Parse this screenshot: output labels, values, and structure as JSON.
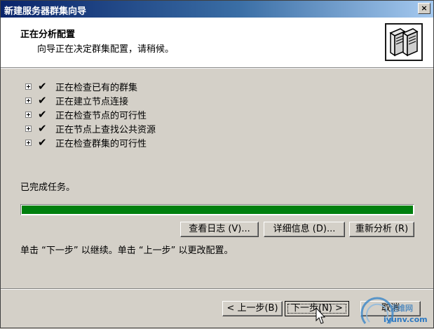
{
  "window": {
    "title": "新建服务器群集向导",
    "close_label": "×"
  },
  "header": {
    "title": "正在分析配置",
    "subtitle": "向导正在决定群集配置，请稍候。",
    "icon": "server-cluster-icon"
  },
  "tasks": [
    {
      "label": "正在检查已有的群集",
      "status": "done"
    },
    {
      "label": "正在建立节点连接",
      "status": "done"
    },
    {
      "label": "正在检查节点的可行性",
      "status": "done"
    },
    {
      "label": "正在节点上查找公共资源",
      "status": "done"
    },
    {
      "label": "正在检查群集的可行性",
      "status": "done"
    }
  ],
  "status_text": "已完成任务。",
  "progress": {
    "percent": 100,
    "color": "#007f0e"
  },
  "buttons": {
    "view_log": "查看日志 (V)...",
    "details": "详细信息 (D)...",
    "reanalyze": "重新分析 (R)"
  },
  "instruction": "单击 “下一步” 以继续。单击 “上一步” 以更改配置。",
  "nav": {
    "back": "< 上一步(B)",
    "next": "下一步(N) >",
    "cancel": "取消"
  },
  "watermark": {
    "line1": "运维网",
    "line2": "iyunv.com"
  },
  "colors": {
    "titlebar_start": "#0a246a",
    "titlebar_end": "#a6caf0",
    "face": "#d4d0c8"
  }
}
